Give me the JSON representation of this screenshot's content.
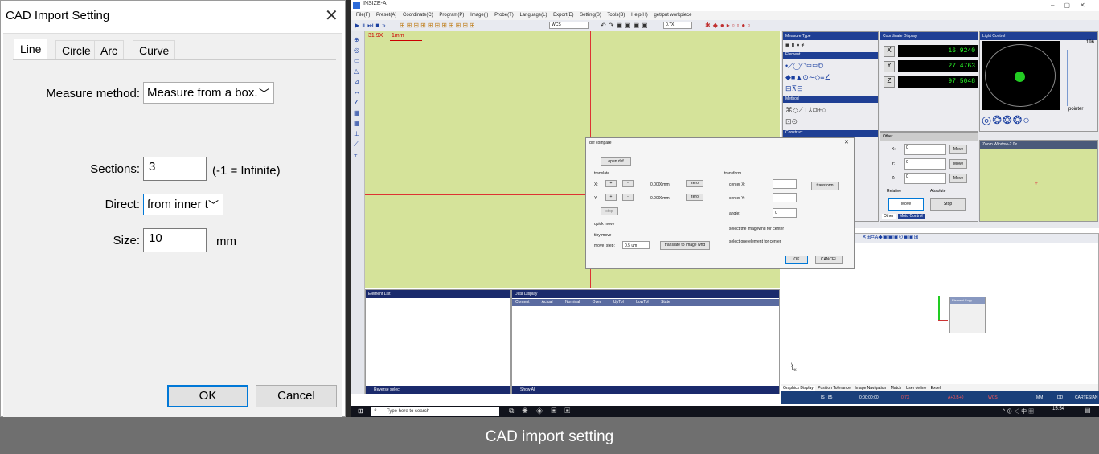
{
  "cad_dialog": {
    "title": "CAD Import Setting",
    "tabs": [
      "Line",
      "Circle",
      "Arc",
      "Curve"
    ],
    "active_tab": "Line",
    "measure_method_label": "Measure method:",
    "measure_method_value": "Measure from a box.",
    "sections_label": "Sections:",
    "sections_value": "3",
    "sections_hint": "(-1 = Infinite)",
    "direct_label": "Direct:",
    "direct_value": "from inner t",
    "size_label": "Size:",
    "size_value": "10",
    "size_unit": "mm",
    "ok_label": "OK",
    "cancel_label": "Cancel"
  },
  "app": {
    "title": "INSIZE-A",
    "menu": [
      "File(F)",
      "Preset(A)",
      "Coordinate(C)",
      "Program(P)",
      "Image(I)",
      "Probe(T)",
      "Language(L)",
      "Export(E)",
      "Setting(S)",
      "Tools(B)",
      "Help(H)",
      "get/put workpiece"
    ],
    "toolbar_combo_1": "WCS",
    "toolbar_combo_2": "0.7X",
    "camera_zoom": "31.9X",
    "camera_scale": "1mm",
    "element_list_title": "Element List",
    "data_display_title": "Data Display",
    "data_columns": [
      "Content",
      "Actual",
      "Nominal",
      "Over",
      "UpTol",
      "LowTol",
      "State"
    ],
    "reverse_select": "Reverse select",
    "show_all": "Show All",
    "measure_type": "Measure Type",
    "element": "Element",
    "method": "Method",
    "construct": "Construct",
    "coordinate_display": "Coordinate Display",
    "x_value": "16.9240",
    "y_value": "27.4763",
    "z_value": "97.5048",
    "unit_glyph": "X/g",
    "light_control": "Light Control",
    "light_value": "196",
    "pointer": "pointer",
    "other_title": "Other",
    "move_x_label": "X:",
    "move_y_label": "Y:",
    "move_z_label": "Z:",
    "move_value": "0",
    "move_btn": "Move",
    "relative": "Relative",
    "absolute": "Absolute",
    "move_big": "Move",
    "stop_big": "Stop",
    "other_tab": "Other",
    "moto_tab": "Moto Control",
    "zoom_window": "Zoom Window-2.0x",
    "element_copy": "Element Copy",
    "bottom_tabs": [
      "Graphics Display",
      "Position Tolerance",
      "Image Navigation",
      "Match",
      "User define",
      "Excel"
    ],
    "status": [
      "IS : 85",
      "0:00:00:00",
      "0.7X",
      "A+0,B+0",
      "WCS",
      "MM",
      "DD",
      "CARTESIAN"
    ],
    "search_placeholder": "Type here to search",
    "clock": "15:54"
  },
  "dxf_dialog": {
    "title": "dxf compare",
    "open_dxf": "open dxf",
    "translate": "translate",
    "x_label": "X:",
    "y_label": "Y:",
    "plus": "+",
    "minus": "-",
    "x_value": "0.0000mm",
    "y_value": "0.0000mm",
    "zero": "zero",
    "stop": "stop",
    "quick_move": "quick move",
    "tiny_move": "tiny move",
    "move_step_label": "move_step:",
    "move_step_value": "0.5 um",
    "translate_image": "translate to image wnd",
    "transform": "transform",
    "center_x": "center X:",
    "center_y": "center Y:",
    "angle": "angle:",
    "angle_value": "0",
    "transform_btn": "transform",
    "select_imagewnd": "select the imagewnd for center",
    "select_element": "select one element for center",
    "ok": "OK",
    "cancel": "CANCEL"
  },
  "caption": "CAD import setting"
}
